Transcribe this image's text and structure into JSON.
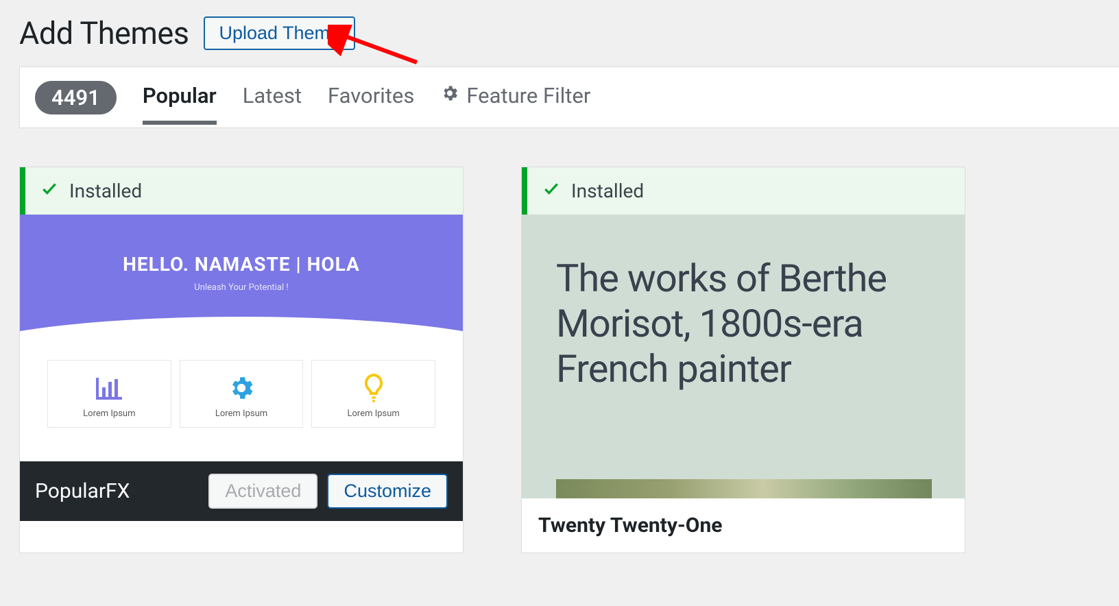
{
  "header": {
    "page_title": "Add Themes",
    "upload_label": "Upload Theme"
  },
  "filters": {
    "count": "4491",
    "tabs": {
      "popular": "Popular",
      "latest": "Latest",
      "favorites": "Favorites",
      "feature_filter": "Feature Filter"
    }
  },
  "themes": [
    {
      "installed_label": "Installed",
      "name": "PopularFX",
      "preview": {
        "headline": "HELLO. NAMASTE | HOLA",
        "tagline": "Unleash Your Potential !",
        "card_label": "Lorem Ipsum"
      },
      "actions": {
        "activated": "Activated",
        "customize": "Customize"
      }
    },
    {
      "installed_label": "Installed",
      "name": "Twenty Twenty-One",
      "preview": {
        "headline": "The works of Berthe Morisot, 1800s-era French painter"
      }
    }
  ]
}
